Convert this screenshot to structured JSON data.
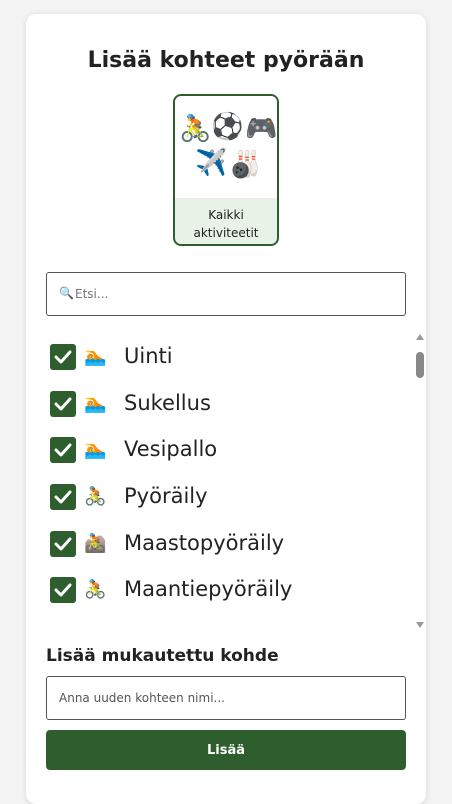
{
  "page": {
    "title": "Lisää kohteet pyörään"
  },
  "category": {
    "label": "Kaikki aktiviteetit",
    "icons": [
      "🚴",
      "⚽",
      "🎮",
      "✈️",
      "🎳"
    ]
  },
  "search": {
    "icon": "🔍",
    "placeholder": "Etsi..."
  },
  "activities": [
    {
      "label": "Uinti",
      "icon": "🏊",
      "checked": true
    },
    {
      "label": "Sukellus",
      "icon": "🏊",
      "checked": true
    },
    {
      "label": "Vesipallo",
      "icon": "🏊",
      "checked": true
    },
    {
      "label": "Pyöräily",
      "icon": "🚴",
      "checked": true
    },
    {
      "label": "Maastopyöräily",
      "icon": "🚵",
      "checked": true
    },
    {
      "label": "Maantiepyöräily",
      "icon": "🚴",
      "checked": true
    }
  ],
  "custom": {
    "heading": "Lisää mukautettu kohde",
    "placeholder": "Anna uuden kohteen nimi...",
    "button_label": "Lisää"
  },
  "colors": {
    "accent": "#2e5e2e",
    "tile_background": "#e9f2e7"
  }
}
